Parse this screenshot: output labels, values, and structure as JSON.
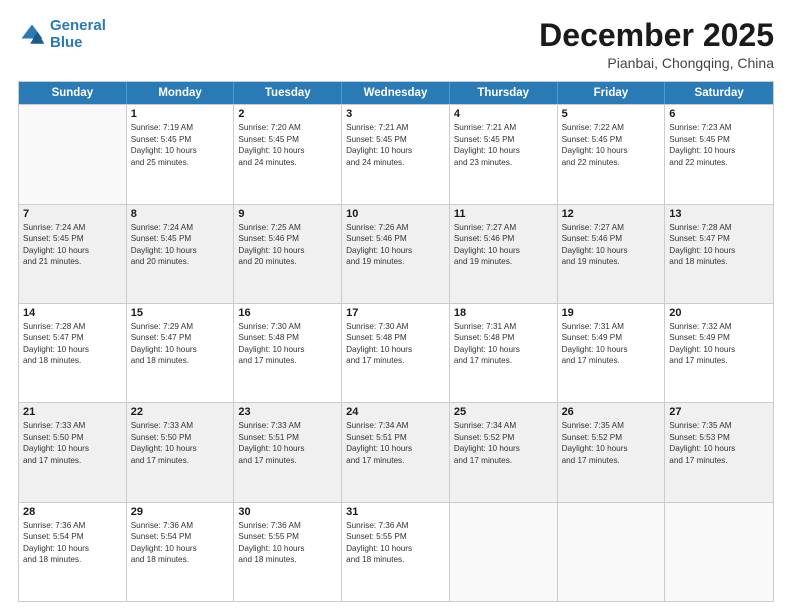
{
  "header": {
    "logo_line1": "General",
    "logo_line2": "Blue",
    "month_title": "December 2025",
    "location": "Pianbai, Chongqing, China"
  },
  "days_of_week": [
    "Sunday",
    "Monday",
    "Tuesday",
    "Wednesday",
    "Thursday",
    "Friday",
    "Saturday"
  ],
  "weeks": [
    [
      {
        "day": "",
        "info": ""
      },
      {
        "day": "1",
        "info": "Sunrise: 7:19 AM\nSunset: 5:45 PM\nDaylight: 10 hours\nand 25 minutes."
      },
      {
        "day": "2",
        "info": "Sunrise: 7:20 AM\nSunset: 5:45 PM\nDaylight: 10 hours\nand 24 minutes."
      },
      {
        "day": "3",
        "info": "Sunrise: 7:21 AM\nSunset: 5:45 PM\nDaylight: 10 hours\nand 24 minutes."
      },
      {
        "day": "4",
        "info": "Sunrise: 7:21 AM\nSunset: 5:45 PM\nDaylight: 10 hours\nand 23 minutes."
      },
      {
        "day": "5",
        "info": "Sunrise: 7:22 AM\nSunset: 5:45 PM\nDaylight: 10 hours\nand 22 minutes."
      },
      {
        "day": "6",
        "info": "Sunrise: 7:23 AM\nSunset: 5:45 PM\nDaylight: 10 hours\nand 22 minutes."
      }
    ],
    [
      {
        "day": "7",
        "info": "Sunrise: 7:24 AM\nSunset: 5:45 PM\nDaylight: 10 hours\nand 21 minutes."
      },
      {
        "day": "8",
        "info": "Sunrise: 7:24 AM\nSunset: 5:45 PM\nDaylight: 10 hours\nand 20 minutes."
      },
      {
        "day": "9",
        "info": "Sunrise: 7:25 AM\nSunset: 5:46 PM\nDaylight: 10 hours\nand 20 minutes."
      },
      {
        "day": "10",
        "info": "Sunrise: 7:26 AM\nSunset: 5:46 PM\nDaylight: 10 hours\nand 19 minutes."
      },
      {
        "day": "11",
        "info": "Sunrise: 7:27 AM\nSunset: 5:46 PM\nDaylight: 10 hours\nand 19 minutes."
      },
      {
        "day": "12",
        "info": "Sunrise: 7:27 AM\nSunset: 5:46 PM\nDaylight: 10 hours\nand 19 minutes."
      },
      {
        "day": "13",
        "info": "Sunrise: 7:28 AM\nSunset: 5:47 PM\nDaylight: 10 hours\nand 18 minutes."
      }
    ],
    [
      {
        "day": "14",
        "info": "Sunrise: 7:28 AM\nSunset: 5:47 PM\nDaylight: 10 hours\nand 18 minutes."
      },
      {
        "day": "15",
        "info": "Sunrise: 7:29 AM\nSunset: 5:47 PM\nDaylight: 10 hours\nand 18 minutes."
      },
      {
        "day": "16",
        "info": "Sunrise: 7:30 AM\nSunset: 5:48 PM\nDaylight: 10 hours\nand 17 minutes."
      },
      {
        "day": "17",
        "info": "Sunrise: 7:30 AM\nSunset: 5:48 PM\nDaylight: 10 hours\nand 17 minutes."
      },
      {
        "day": "18",
        "info": "Sunrise: 7:31 AM\nSunset: 5:48 PM\nDaylight: 10 hours\nand 17 minutes."
      },
      {
        "day": "19",
        "info": "Sunrise: 7:31 AM\nSunset: 5:49 PM\nDaylight: 10 hours\nand 17 minutes."
      },
      {
        "day": "20",
        "info": "Sunrise: 7:32 AM\nSunset: 5:49 PM\nDaylight: 10 hours\nand 17 minutes."
      }
    ],
    [
      {
        "day": "21",
        "info": "Sunrise: 7:33 AM\nSunset: 5:50 PM\nDaylight: 10 hours\nand 17 minutes."
      },
      {
        "day": "22",
        "info": "Sunrise: 7:33 AM\nSunset: 5:50 PM\nDaylight: 10 hours\nand 17 minutes."
      },
      {
        "day": "23",
        "info": "Sunrise: 7:33 AM\nSunset: 5:51 PM\nDaylight: 10 hours\nand 17 minutes."
      },
      {
        "day": "24",
        "info": "Sunrise: 7:34 AM\nSunset: 5:51 PM\nDaylight: 10 hours\nand 17 minutes."
      },
      {
        "day": "25",
        "info": "Sunrise: 7:34 AM\nSunset: 5:52 PM\nDaylight: 10 hours\nand 17 minutes."
      },
      {
        "day": "26",
        "info": "Sunrise: 7:35 AM\nSunset: 5:52 PM\nDaylight: 10 hours\nand 17 minutes."
      },
      {
        "day": "27",
        "info": "Sunrise: 7:35 AM\nSunset: 5:53 PM\nDaylight: 10 hours\nand 17 minutes."
      }
    ],
    [
      {
        "day": "28",
        "info": "Sunrise: 7:36 AM\nSunset: 5:54 PM\nDaylight: 10 hours\nand 18 minutes."
      },
      {
        "day": "29",
        "info": "Sunrise: 7:36 AM\nSunset: 5:54 PM\nDaylight: 10 hours\nand 18 minutes."
      },
      {
        "day": "30",
        "info": "Sunrise: 7:36 AM\nSunset: 5:55 PM\nDaylight: 10 hours\nand 18 minutes."
      },
      {
        "day": "31",
        "info": "Sunrise: 7:36 AM\nSunset: 5:55 PM\nDaylight: 10 hours\nand 18 minutes."
      },
      {
        "day": "",
        "info": ""
      },
      {
        "day": "",
        "info": ""
      },
      {
        "day": "",
        "info": ""
      }
    ]
  ]
}
